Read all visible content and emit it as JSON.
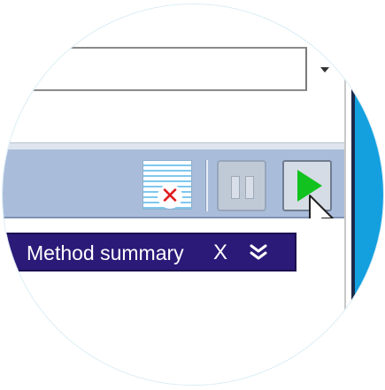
{
  "combo": {
    "value": ""
  },
  "toolbar": {
    "clear_icon": "clear-log-icon",
    "pause_icon": "pause-icon",
    "play_icon": "play-icon"
  },
  "panel": {
    "tab_title": "Method summary",
    "close_label": "X",
    "expand_icon": "double-chevron-down-icon"
  },
  "colors": {
    "toolbar_bg": "#a9bddb",
    "tab_bg": "#2b1a78",
    "play_green": "#12c21f",
    "accent_blue": "#14a0df",
    "clear_red": "#e0191b"
  }
}
